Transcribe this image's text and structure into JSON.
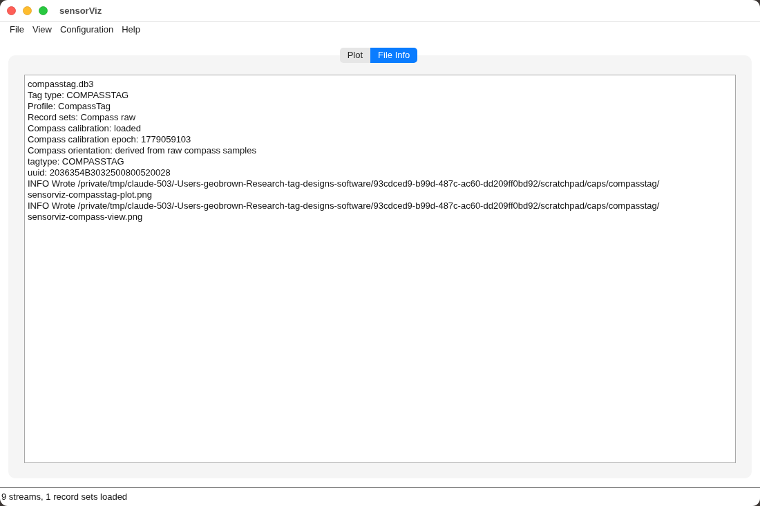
{
  "window": {
    "title": "sensorViz"
  },
  "menu": [
    "File",
    "View",
    "Configuration",
    "Help"
  ],
  "tabs": [
    {
      "label": "Plot",
      "selected": false
    },
    {
      "label": "File Info",
      "selected": true
    }
  ],
  "file_info": {
    "lines": [
      "compasstag.db3",
      "Tag type: COMPASSTAG",
      "Profile: CompassTag",
      "Record sets: Compass raw",
      "Compass calibration: loaded",
      "Compass calibration epoch: 1779059103",
      "Compass orientation: derived from raw compass samples",
      "tagtype: COMPASSTAG",
      "uuid: 2036354B3032500800520028",
      "INFO Wrote /private/tmp/claude-503/-Users-geobrown-Research-tag-designs-software/93cdced9-b99d-487c-ac60-dd209ff0bd92/scratchpad/caps/compasstag/",
      "sensorviz-compasstag-plot.png",
      "INFO Wrote /private/tmp/claude-503/-Users-geobrown-Research-tag-designs-software/93cdced9-b99d-487c-ac60-dd209ff0bd92/scratchpad/caps/compasstag/",
      "sensorviz-compass-view.png"
    ]
  },
  "status_bar": "9 streams, 1 record sets loaded"
}
